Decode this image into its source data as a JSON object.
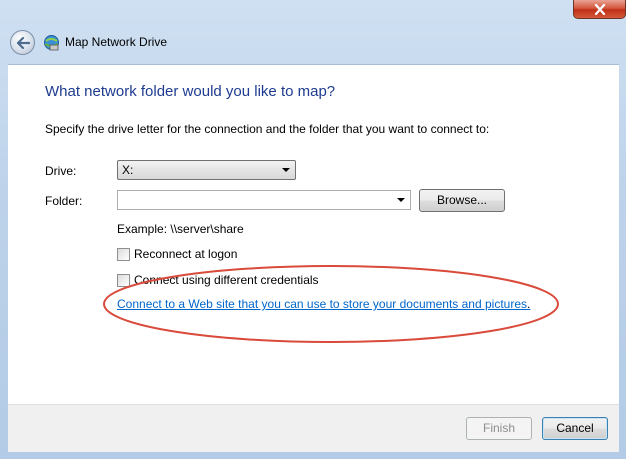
{
  "window": {
    "title": "Map Network Drive"
  },
  "titlebar": {
    "back_icon": "back-arrow-icon",
    "app_icon": "network-drive-icon",
    "close_icon": "close-icon"
  },
  "dialog": {
    "heading": "What network folder would you like to map?",
    "instructions": "Specify the drive letter for the connection and the folder that you want to connect to:",
    "drive_label": "Drive:",
    "drive_value": "X:",
    "folder_label": "Folder:",
    "folder_value": "",
    "browse_label": "Browse...",
    "example": "Example: \\\\server\\share",
    "reconnect_label": "Reconnect at logon",
    "reconnect_checked": false,
    "credentials_label": "Connect using different credentials",
    "credentials_checked": false,
    "web_link": "Connect to a Web site that you can use to store your documents and pictures",
    "web_link_suffix": "."
  },
  "footer": {
    "finish_label": "Finish",
    "cancel_label": "Cancel"
  },
  "colors": {
    "heading": "#1e3b8f",
    "link": "#0066cc",
    "annotation": "#d94a3a",
    "frame": "#bed3ea"
  }
}
